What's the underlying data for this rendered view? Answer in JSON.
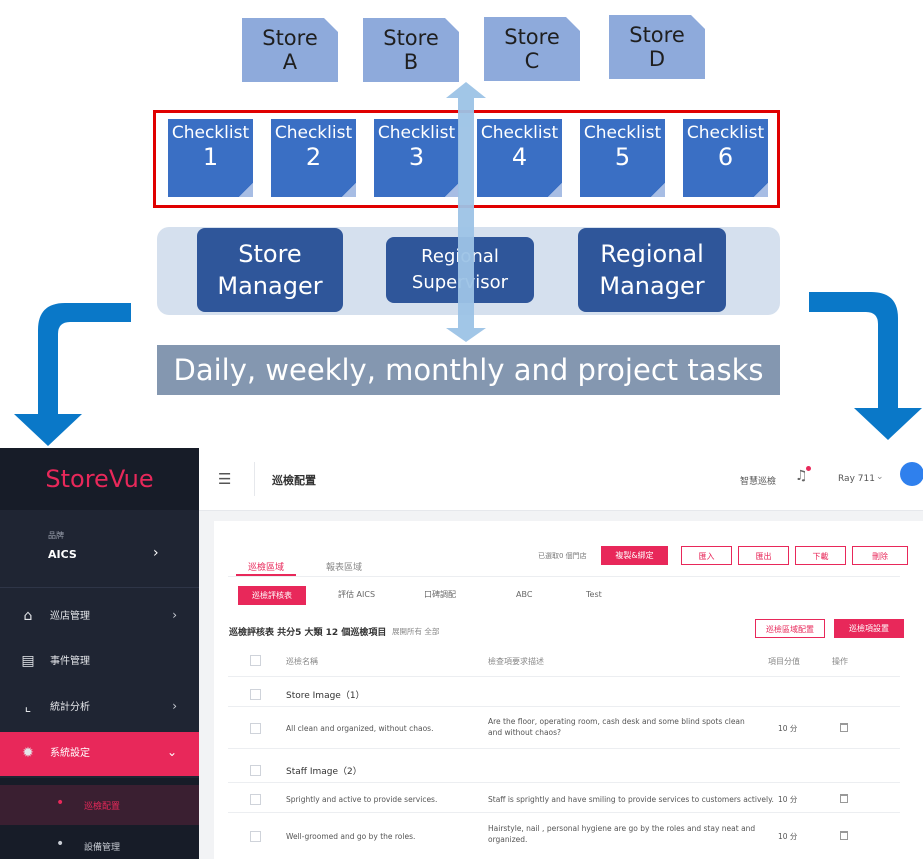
{
  "diagram": {
    "stores": [
      "Store\nA",
      "Store\nB",
      "Store\nC",
      "Store\nD"
    ],
    "checklists": [
      {
        "label": "Checklist",
        "num": "1"
      },
      {
        "label": "Checklist",
        "num": "2"
      },
      {
        "label": "Checklist",
        "num": "3"
      },
      {
        "label": "Checklist",
        "num": "4"
      },
      {
        "label": "Checklist",
        "num": "5"
      },
      {
        "label": "Checklist",
        "num": "6"
      }
    ],
    "roles": [
      "Store\nManager",
      "Regional\nSupervisor",
      "Regional\nManager"
    ],
    "tasks": "Daily, weekly, monthly and project tasks"
  },
  "app": {
    "brand": "StoreVue",
    "brand_color": "#e8285a",
    "sidebar": {
      "org_label": "品牌",
      "org_value": "AICS",
      "items": [
        {
          "icon": "home-icon",
          "label": "巡店管理",
          "chevron": "›"
        },
        {
          "icon": "clipboard-icon",
          "label": "事件管理",
          "chevron": ""
        },
        {
          "icon": "chart-icon",
          "label": "統計分析",
          "chevron": "›"
        },
        {
          "icon": "gear-icon",
          "label": "系統設定",
          "chevron": "⌄"
        }
      ],
      "sub_items": [
        "巡檢配置",
        "設備管理"
      ]
    },
    "topbar": {
      "title": "巡檢配置",
      "link": "智慧巡檢",
      "user": "Ray 711"
    },
    "tabs": [
      "巡檢區域",
      "報表區域"
    ],
    "hint": "已選取0 個門店",
    "actions": [
      "複製&綁定",
      "匯入",
      "匯出",
      "下載",
      "刪除"
    ],
    "subtabs": [
      "巡檢評核表",
      "評估 AICS",
      "口碑調配",
      "ABC",
      "Test"
    ],
    "summary": "巡檢評核表 共分5 大類 12 個巡檢項目",
    "summary_link": "展開所有 全部",
    "summary_buttons": [
      "巡檢區域配置",
      "巡檢項設置"
    ],
    "columns": [
      "巡檢名稱",
      "檢查項要求描述",
      "項目分值",
      "操作"
    ],
    "groups": [
      {
        "name": "Store Image（1）",
        "rows": [
          {
            "name": "All clean and organized, without chaos.",
            "desc": "Are the floor, operating room, cash desk and some blind spots clean and without chaos?",
            "score": "10 分"
          }
        ]
      },
      {
        "name": "Staff Image（2）",
        "rows": [
          {
            "name": "Sprightly and active to provide services.",
            "desc": "Staff is sprightly and have smiling to provide services to customers actively.",
            "score": "10 分"
          },
          {
            "name": "Well-groomed and go by the roles.",
            "desc": "Hairstyle, nail , personal hygiene are go by the roles and stay neat and organized.",
            "score": "10 分"
          }
        ]
      }
    ]
  }
}
